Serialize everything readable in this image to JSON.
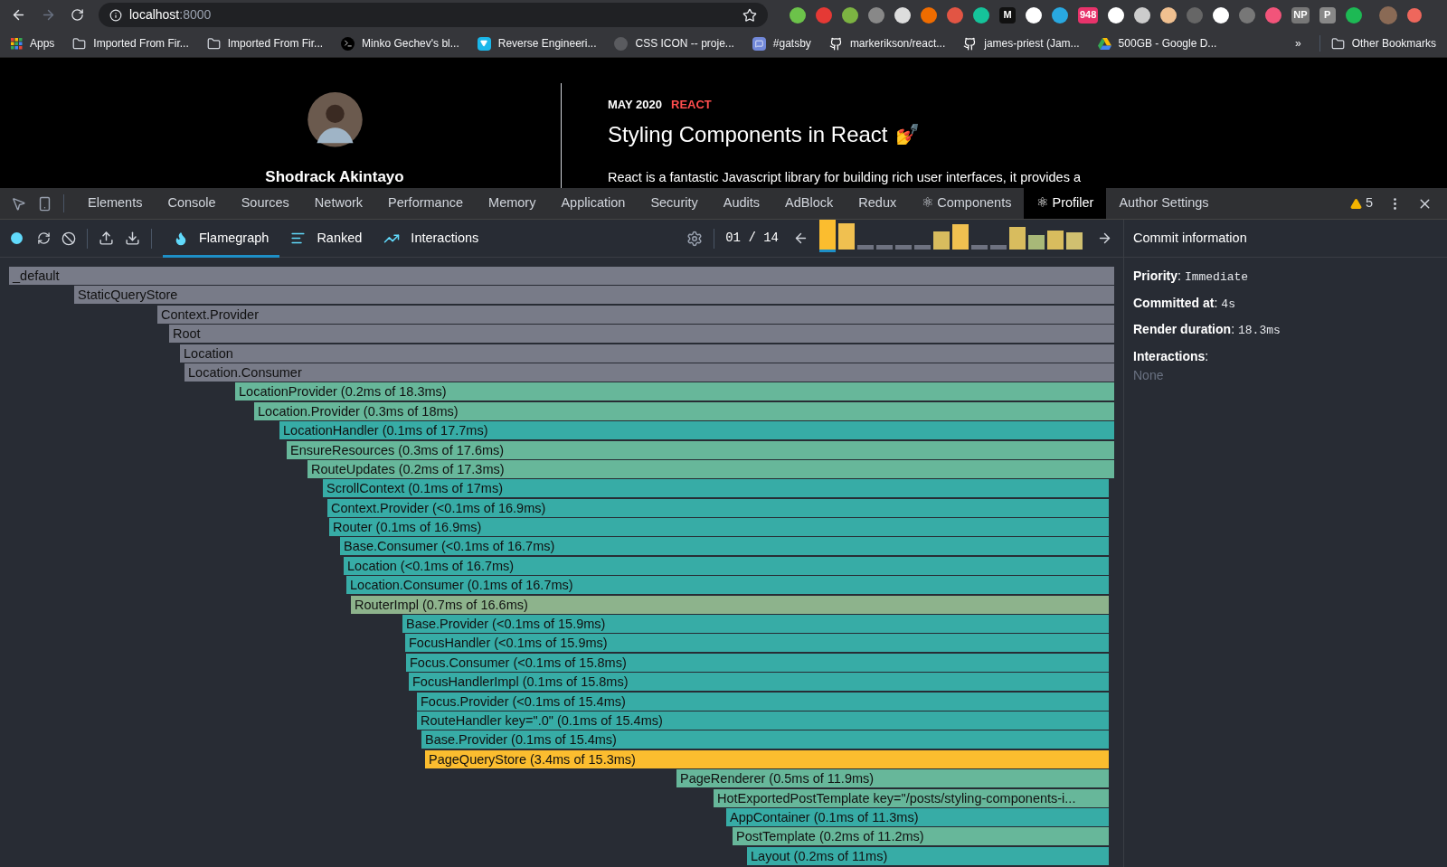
{
  "browser": {
    "address": {
      "host": "localhost",
      "port": ":8000"
    },
    "extensions": [
      {
        "color": "#6cc24a"
      },
      {
        "color": "#e53935"
      },
      {
        "color": "#7cb342"
      },
      {
        "color": "#888888"
      },
      {
        "color": "#dddddd"
      },
      {
        "color": "#ef6c00"
      },
      {
        "color": "#e25544"
      },
      {
        "color": "#15c39a"
      },
      {
        "color": "#111111",
        "label": "M"
      },
      {
        "color": "#ffffff"
      },
      {
        "color": "#29a8e0"
      },
      {
        "color": "#e8336b",
        "label": "948"
      },
      {
        "color": "#ffffff"
      },
      {
        "color": "#cccccc"
      },
      {
        "color": "#f0c090"
      },
      {
        "color": "#666666"
      },
      {
        "color": "#ffffff"
      },
      {
        "color": "#777777"
      },
      {
        "color": "#f2547a"
      },
      {
        "color": "#777777",
        "label": "NP"
      },
      {
        "color": "#888888",
        "label": "P"
      },
      {
        "color": "#1db954"
      }
    ],
    "bookmarks": [
      {
        "label": "Apps",
        "kind": "apps"
      },
      {
        "label": "Imported From Fir...",
        "kind": "folder"
      },
      {
        "label": "Imported From Fir...",
        "kind": "folder"
      },
      {
        "label": "Minko Gechev's bl...",
        "kind": "terminal"
      },
      {
        "label": "Reverse Engineeri...",
        "kind": "vimeo"
      },
      {
        "label": "CSS ICON -- proje...",
        "kind": "blank"
      },
      {
        "label": "#gatsby",
        "kind": "discord"
      },
      {
        "label": "markerikson/react...",
        "kind": "github"
      },
      {
        "label": "james-priest (Jam...",
        "kind": "github"
      },
      {
        "label": "500GB - Google D...",
        "kind": "drive"
      }
    ],
    "more": "»",
    "other": "Other Bookmarks"
  },
  "page": {
    "author": "Shodrack Akintayo",
    "date": "MAY 2020",
    "tag": "REACT",
    "title": "Styling Components in React",
    "emoji": "💅",
    "excerpt": "React is a fantastic Javascript library for building rich user interfaces, it provides a"
  },
  "devtools": {
    "tabs": [
      {
        "label": "Elements",
        "selected": false
      },
      {
        "label": "Console",
        "selected": false
      },
      {
        "label": "Sources",
        "selected": false
      },
      {
        "label": "Network",
        "selected": false
      },
      {
        "label": "Performance",
        "selected": false
      },
      {
        "label": "Memory",
        "selected": false
      },
      {
        "label": "Application",
        "selected": false
      },
      {
        "label": "Security",
        "selected": false
      },
      {
        "label": "Audits",
        "selected": false
      },
      {
        "label": "AdBlock",
        "selected": false
      },
      {
        "label": "Redux",
        "selected": false
      },
      {
        "label": "⚛ Components",
        "selected": false
      },
      {
        "label": "⚛ Profiler",
        "selected": true
      },
      {
        "label": "Author Settings",
        "selected": false
      }
    ],
    "warnings": "5"
  },
  "profiler": {
    "views": [
      {
        "label": "Flamegraph",
        "kind": "flame",
        "selected": true
      },
      {
        "label": "Ranked",
        "kind": "ranked",
        "selected": false
      },
      {
        "label": "Interactions",
        "kind": "interactions",
        "selected": false
      }
    ],
    "commit_counter": "01 / 14",
    "commits": [
      {
        "color": "#fbbd2f",
        "selected": true
      },
      {
        "color": "#f0c050",
        "selected": false
      },
      {
        "color": "#6e7280",
        "selected": false
      },
      {
        "color": "#6e7280",
        "selected": false
      },
      {
        "color": "#6e7280",
        "selected": false
      },
      {
        "color": "#6e7280",
        "selected": false
      },
      {
        "color": "#d8bc5e",
        "selected": false
      },
      {
        "color": "#f0c050",
        "selected": false
      },
      {
        "color": "#6e7280",
        "selected": false
      },
      {
        "color": "#6e7280",
        "selected": false
      },
      {
        "color": "#d8bc5e",
        "selected": false
      },
      {
        "color": "#a8b878",
        "selected": false
      },
      {
        "color": "#d8bc5e",
        "selected": false
      },
      {
        "color": "#d0c070",
        "selected": false
      }
    ],
    "flame": [
      {
        "label": "_default",
        "color": "#787b88"
      },
      {
        "label": "StaticQueryStore",
        "color": "#787b88"
      },
      {
        "label": "Context.Provider",
        "color": "#787b88"
      },
      {
        "label": "Root",
        "color": "#787b88"
      },
      {
        "label": "Location",
        "color": "#787b88"
      },
      {
        "label": "Location.Consumer",
        "color": "#787b88"
      },
      {
        "label": "LocationProvider (0.2ms of 18.3ms)",
        "color": "#67b79a"
      },
      {
        "label": "Location.Provider (0.3ms of 18ms)",
        "color": "#67b79a"
      },
      {
        "label": "LocationHandler (0.1ms of 17.7ms)",
        "color": "#37aca6"
      },
      {
        "label": "EnsureResources (0.3ms of 17.6ms)",
        "color": "#67b79a"
      },
      {
        "label": "RouteUpdates (0.2ms of 17.3ms)",
        "color": "#67b79a"
      },
      {
        "label": "ScrollContext (0.1ms of 17ms)",
        "color": "#37aca6"
      },
      {
        "label": "Context.Provider (<0.1ms of 16.9ms)",
        "color": "#37aca6"
      },
      {
        "label": "Router (0.1ms of 16.9ms)",
        "color": "#37aca6"
      },
      {
        "label": "Base.Consumer (<0.1ms of 16.7ms)",
        "color": "#37aca6"
      },
      {
        "label": "Location (<0.1ms of 16.7ms)",
        "color": "#37aca6"
      },
      {
        "label": "Location.Consumer (0.1ms of 16.7ms)",
        "color": "#37aca6"
      },
      {
        "label": "RouterImpl (0.7ms of 16.6ms)",
        "color": "#8db38c"
      },
      {
        "label": "Base.Provider (<0.1ms of 15.9ms)",
        "color": "#37aca6"
      },
      {
        "label": "FocusHandler (<0.1ms of 15.9ms)",
        "color": "#37aca6"
      },
      {
        "label": "Focus.Consumer (<0.1ms of 15.8ms)",
        "color": "#37aca6"
      },
      {
        "label": "FocusHandlerImpl (0.1ms of 15.8ms)",
        "color": "#37aca6"
      },
      {
        "label": "Focus.Provider (<0.1ms of 15.4ms)",
        "color": "#37aca6"
      },
      {
        "label": "RouteHandler key=\".0\" (0.1ms of 15.4ms)",
        "color": "#37aca6"
      },
      {
        "label": "Base.Provider (0.1ms of 15.4ms)",
        "color": "#37aca6"
      },
      {
        "label": "PageQueryStore (3.4ms of 15.3ms)",
        "color": "#fbbd2f"
      },
      {
        "label": "PageRenderer (0.5ms of 11.9ms)",
        "color": "#67b79a"
      },
      {
        "label": "HotExportedPostTemplate key=\"/posts/styling-components-i...",
        "color": "#67b79a"
      },
      {
        "label": "AppContainer (0.1ms of 11.3ms)",
        "color": "#37aca6"
      },
      {
        "label": "PostTemplate (0.2ms of 11.2ms)",
        "color": "#67b79a"
      },
      {
        "label": "Layout (0.2ms of 11ms)",
        "color": "#37aca6"
      }
    ],
    "commit_info": {
      "heading": "Commit information",
      "fields": [
        {
          "label": "**Priority**:",
          "value": "Immediate"
        },
        {
          "label": "**Committed at**:",
          "value": "4s"
        },
        {
          "label": "**Render duration**:",
          "value": "18.3ms"
        }
      ],
      "interactions_label": "**Interactions**:",
      "interactions_value": "None"
    }
  }
}
